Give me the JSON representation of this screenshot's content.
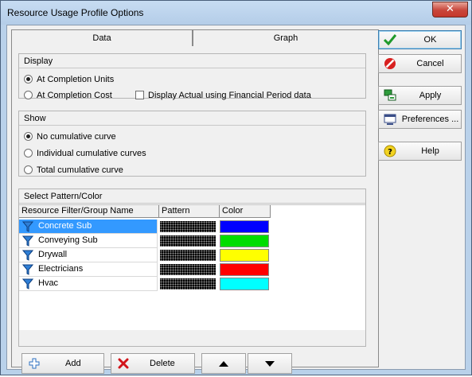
{
  "window": {
    "title": "Resource Usage Profile Options",
    "close_glyph": "✕"
  },
  "tabs": [
    {
      "label": "Data"
    },
    {
      "label": "Graph"
    }
  ],
  "display": {
    "header": "Display",
    "options": [
      {
        "label": "At Completion Units",
        "checked": true
      },
      {
        "label": "At Completion Cost",
        "checked": false
      }
    ],
    "checkbox_label": "Display Actual using Financial Period data"
  },
  "show": {
    "header": "Show",
    "options": [
      {
        "label": "No cumulative curve",
        "checked": true
      },
      {
        "label": "Individual cumulative curves",
        "checked": false
      },
      {
        "label": "Total cumulative curve",
        "checked": false
      }
    ]
  },
  "pattern": {
    "header": "Select Pattern/Color",
    "columns": [
      "Resource Filter/Group Name",
      "Pattern",
      "Color"
    ],
    "rows": [
      {
        "name": "Concrete Sub",
        "color": "#0000ff",
        "selected": true
      },
      {
        "name": "Conveying Sub",
        "color": "#00dd00",
        "selected": false
      },
      {
        "name": "Drywall",
        "color": "#ffff00",
        "selected": false
      },
      {
        "name": "Electricians",
        "color": "#ff0000",
        "selected": false
      },
      {
        "name": "Hvac",
        "color": "#00ffff",
        "selected": false
      }
    ]
  },
  "toolbar": {
    "add_label": "Add",
    "delete_label": "Delete"
  },
  "side_buttons": {
    "ok": "OK",
    "cancel": "Cancel",
    "apply": "Apply",
    "preferences": "Preferences ...",
    "help": "Help"
  }
}
